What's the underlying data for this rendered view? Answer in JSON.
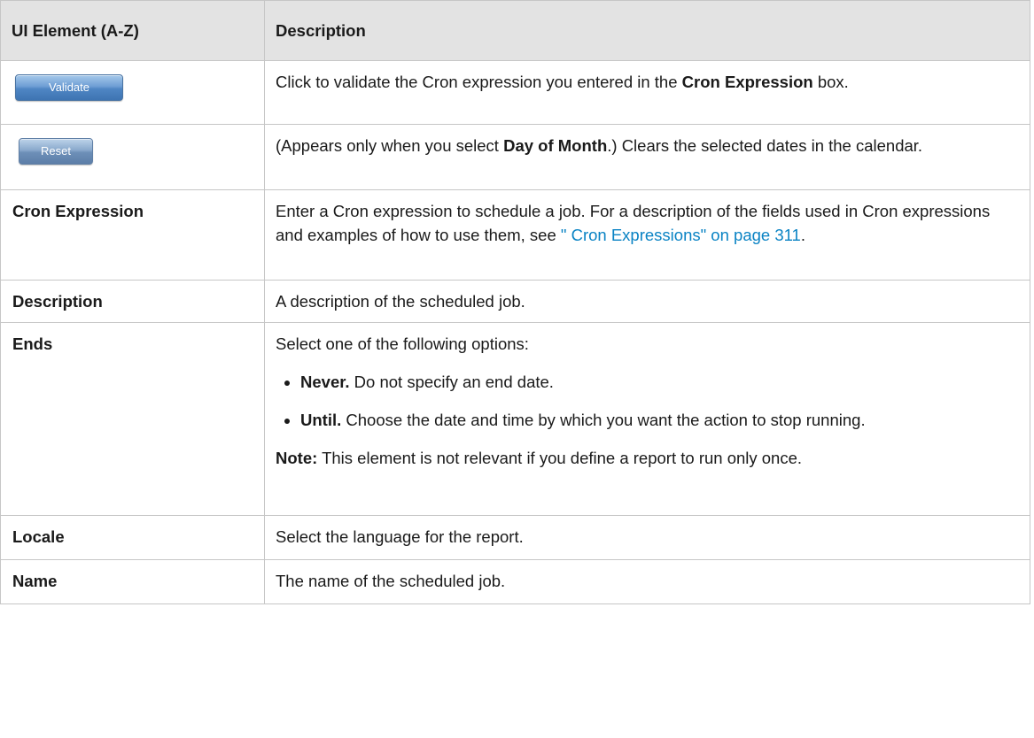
{
  "header": {
    "col1": "UI Element (A-Z)",
    "col2": "Description"
  },
  "rows": {
    "validate": {
      "button_label": "Validate",
      "desc_before": "Click to validate the Cron expression you entered in the ",
      "desc_bold": "Cron Expression",
      "desc_after": " box."
    },
    "reset": {
      "button_label": "Reset",
      "desc_before": "(Appears only when you select ",
      "desc_bold": "Day of Month",
      "desc_after": ".) Clears the selected dates in the calendar."
    },
    "cron_expression": {
      "label": "Cron Expression",
      "desc_before": "Enter a Cron expression to schedule a job. For a description of the fields used in Cron expressions and examples of how to use them, see ",
      "link": "\" Cron Expressions\" on page 311",
      "desc_after": "."
    },
    "description": {
      "label": "Description",
      "desc": "A description of the scheduled job."
    },
    "ends": {
      "label": "Ends",
      "intro": "Select one of the following options:",
      "options": [
        {
          "bold": "Never.",
          "text": " Do not specify an end date."
        },
        {
          "bold": "Until.",
          "text": " Choose the date and time by which you want the action to stop running."
        }
      ],
      "note_bold": "Note:",
      "note_text": " This element is not relevant if you define a report to run only once."
    },
    "locale": {
      "label": "Locale",
      "desc": "Select the language for the report."
    },
    "name": {
      "label": "Name",
      "desc": "The name of the scheduled job."
    }
  }
}
